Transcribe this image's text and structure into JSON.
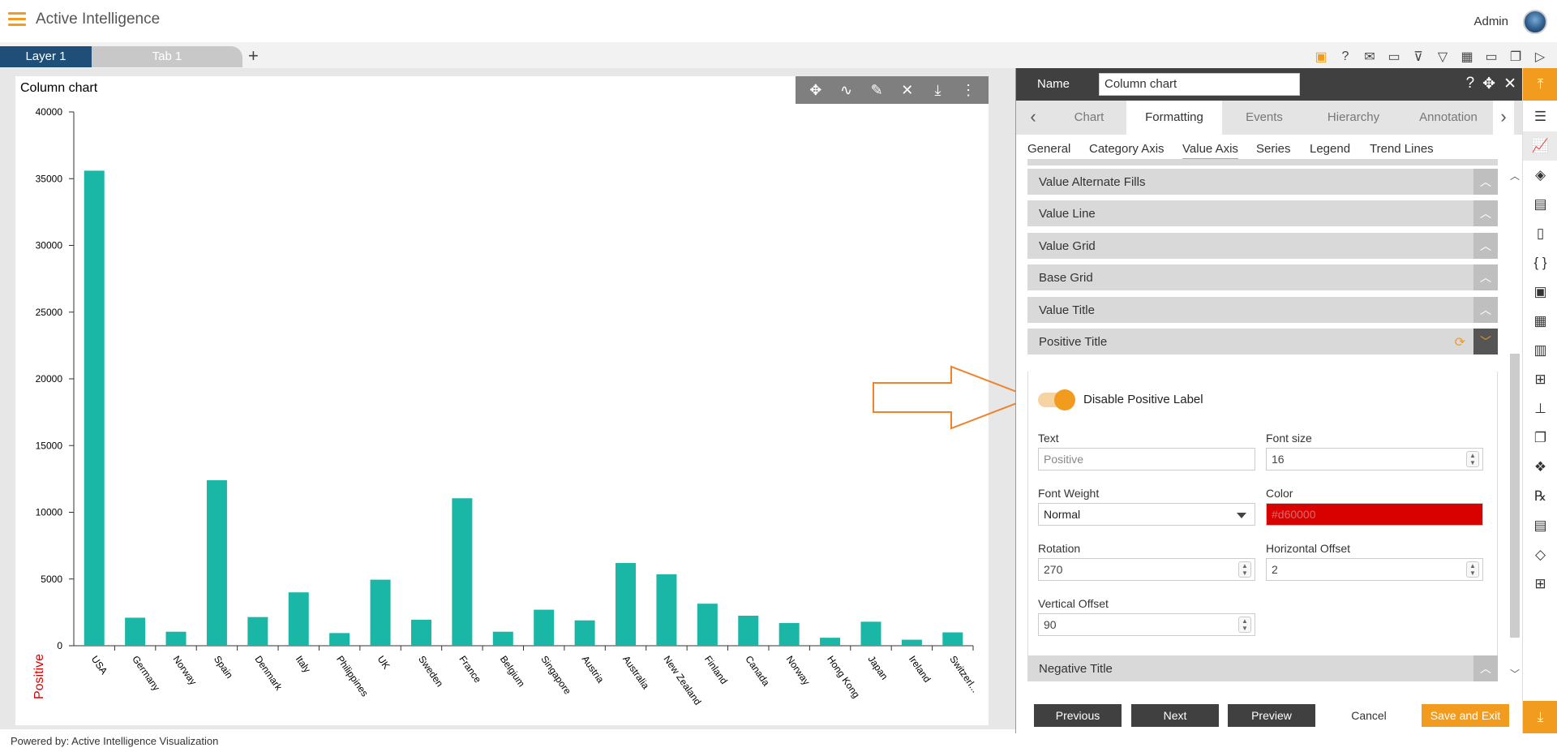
{
  "app": {
    "title": "Active Intelligence",
    "user": "Admin"
  },
  "tabs": {
    "layer": "Layer 1",
    "tab1": "Tab 1",
    "add": "+"
  },
  "toolbar_icons": [
    "save-icon",
    "help-icon",
    "mail-icon",
    "comment-icon",
    "filter-clear-icon",
    "filter-icon",
    "table-icon",
    "monitor-icon",
    "devices-icon",
    "play-icon"
  ],
  "chart_card": {
    "title": "Column chart"
  },
  "chart_data": {
    "type": "bar",
    "title": "Column chart",
    "categories": [
      "USA",
      "Germany",
      "Norway",
      "Spain",
      "Denmark",
      "Italy",
      "Philippines",
      "UK",
      "Sweden",
      "France",
      "Belgium",
      "Singapore",
      "Austria",
      "Australia",
      "New Zealand",
      "Finland",
      "Canada",
      "Norway",
      "Hong Kong",
      "Japan",
      "Ireland",
      "Switzerl..."
    ],
    "values": [
      35600,
      2100,
      1050,
      12400,
      2150,
      4000,
      950,
      4950,
      1950,
      11050,
      1050,
      2700,
      1900,
      6200,
      5350,
      3150,
      2250,
      1700,
      600,
      1800,
      450,
      1000
    ],
    "ylim": [
      0,
      40000
    ],
    "yticks": [
      "0",
      "5000",
      "10000",
      "15000",
      "20000",
      "25000",
      "30000",
      "35000",
      "40000"
    ],
    "ylabel": "Positive",
    "ylabel_color": "#d90000",
    "bar_color": "#1ab7a7",
    "grid": false
  },
  "footer": {
    "powered": "Powered by: Active Intelligence Visualization"
  },
  "panel": {
    "name_label": "Name",
    "name_value": "Column chart",
    "main_tabs": [
      "Chart",
      "Formatting",
      "Events",
      "Hierarchy",
      "Annotation"
    ],
    "sub_tabs": [
      "General",
      "Category Axis",
      "Value Axis",
      "Series",
      "Legend",
      "Trend Lines"
    ],
    "sections": [
      "Value Alternate Fills",
      "Value Line",
      "Value Grid",
      "Base Grid",
      "Value Title",
      "Positive Title"
    ],
    "last_section": "Negative Title",
    "toggle_label": "Disable Positive Label",
    "fields": {
      "text_label": "Text",
      "text_value": "Positive",
      "font_size_label": "Font size",
      "font_size_value": "16",
      "font_weight_label": "Font Weight",
      "font_weight_value": "Normal",
      "color_label": "Color",
      "color_value": "#d60000",
      "rotation_label": "Rotation",
      "rotation_value": "270",
      "hoffset_label": "Horizontal Offset",
      "hoffset_value": "2",
      "voffset_label": "Vertical Offset",
      "voffset_value": "90"
    },
    "buttons": {
      "previous": "Previous",
      "next": "Next",
      "preview": "Preview",
      "cancel": "Cancel",
      "save": "Save and Exit"
    }
  },
  "colors": {
    "accent": "#f29c1f",
    "dark": "#404040",
    "navy": "#1f4e79",
    "color_swatch": "#d90000"
  }
}
